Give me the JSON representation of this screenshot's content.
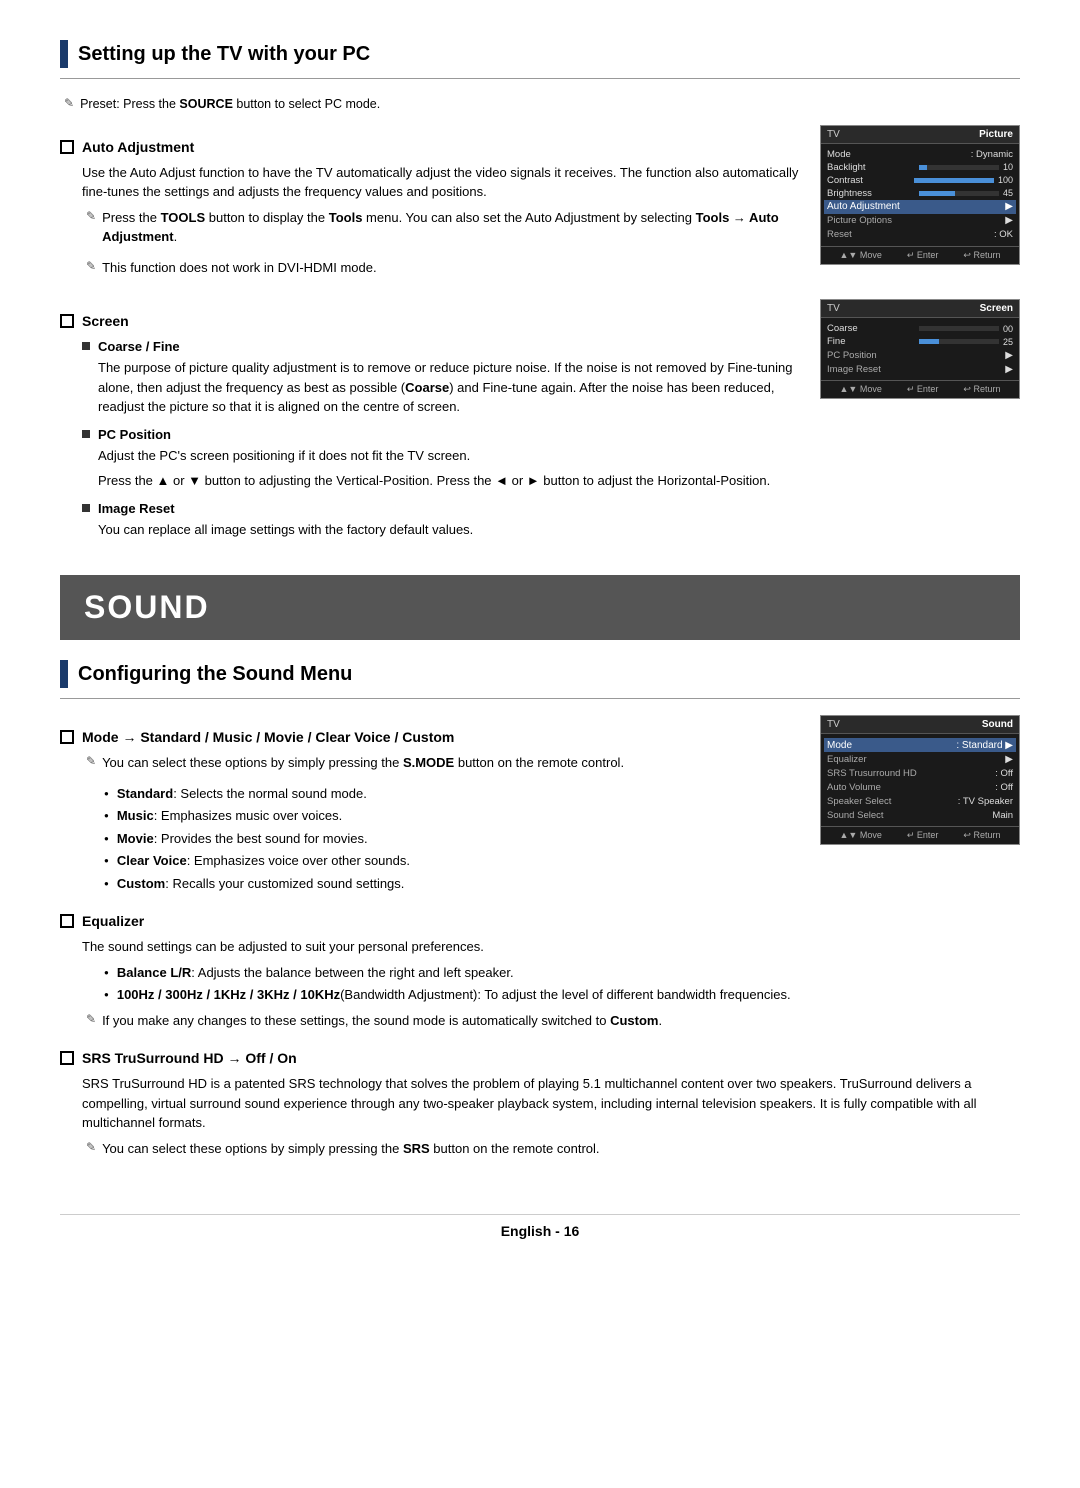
{
  "page": {
    "footer_text": "English - 16"
  },
  "section1": {
    "title": "Setting up the TV with your PC",
    "preset_note": "Preset: Press the SOURCE button to select PC mode.",
    "auto_adjustment": {
      "heading": "Auto Adjustment",
      "para1": "Use the Auto Adjust function to have the TV automatically adjust the video signals it receives. The function also automatically fine-tunes the settings and adjusts the frequency values and positions.",
      "note1": "Press the TOOLS button to display the Tools menu. You can also set the Auto Adjustment by selecting Tools → Auto Adjustment.",
      "note2": "This function does not work in DVI-HDMI mode."
    },
    "screen": {
      "heading": "Screen",
      "coarse_fine": {
        "subheading": "Coarse / Fine",
        "para": "The purpose of picture quality adjustment is to remove or reduce picture noise. If the noise is not removed by Fine-tuning alone, then adjust the frequency as best as possible (Coarse) and Fine-tune again. After the noise has been reduced, readjust the picture so that it is aligned on the centre of screen."
      },
      "pc_position": {
        "subheading": "PC Position",
        "para1": "Adjust the PC's screen positioning if it does not fit the TV screen.",
        "para2": "Press the ▲ or ▼ button to adjusting the Vertical-Position. Press the ◄ or ► button to adjust the Horizontal-Position."
      },
      "image_reset": {
        "subheading": "Image Reset",
        "para": "You can replace all image settings with the factory default values."
      }
    },
    "tv_picture": {
      "header_left": "TV",
      "header_right": "Picture",
      "rows": [
        {
          "label": "Mode",
          "value": ": Dynamic"
        },
        {
          "label": "Backlight",
          "value": "10",
          "is_bar": true,
          "fill_pct": 10
        },
        {
          "label": "Contrast",
          "value": "100",
          "is_bar": true,
          "fill_pct": 100
        },
        {
          "label": "Brightness",
          "value": "45",
          "is_bar": true,
          "fill_pct": 45
        }
      ],
      "selected_row": "Auto Adjustment",
      "extra_rows": [
        {
          "label": "Picture Options",
          "value": ""
        },
        {
          "label": "Reset",
          "value": ": OK"
        }
      ],
      "footer_items": [
        "▲▼ Move",
        "↵ Enter",
        "↩ Return"
      ]
    },
    "tv_screen": {
      "header_left": "TV",
      "header_right": "Screen",
      "rows": [
        {
          "label": "Coarse",
          "value": "00",
          "is_bar": true,
          "fill_pct": 0
        },
        {
          "label": "Fine",
          "value": "25",
          "is_bar": true,
          "fill_pct": 25
        },
        {
          "label": "PC Position",
          "value": ""
        },
        {
          "label": "Image Reset",
          "value": ""
        }
      ],
      "footer_items": [
        "▲▼ Move",
        "↵ Enter",
        "↩ Return"
      ]
    }
  },
  "section2": {
    "banner": "SOUND",
    "title": "Configuring the Sound Menu",
    "mode": {
      "heading": "Mode → Standard / Music / Movie / Clear Voice / Custom",
      "note1": "You can select these options by simply pressing the S.MODE button on the remote control.",
      "bullets": [
        "Standard: Selects the normal sound mode.",
        "Music: Emphasizes music over voices.",
        "Movie: Provides the best sound for movies.",
        "Clear Voice: Emphasizes voice over other sounds.",
        "Custom: Recalls your customized sound settings."
      ]
    },
    "equalizer": {
      "heading": "Equalizer",
      "para": "The sound settings can be adjusted to suit your personal preferences.",
      "bullets": [
        "Balance L/R: Adjusts the balance between the right and left speaker.",
        "100Hz / 300Hz / 1KHz / 3KHz / 10KHz (Bandwidth Adjustment): To adjust the level of different bandwidth frequencies."
      ],
      "note": "If you make any changes to these settings, the sound mode is automatically switched to Custom."
    },
    "srs": {
      "heading": "SRS TruSurround HD → Off / On",
      "para1": "SRS TruSurround HD is a patented SRS technology that solves the problem of playing 5.1 multichannel content over two speakers. TruSurround delivers a compelling, virtual surround sound experience through any two-speaker playback system, including internal television speakers. It is fully compatible with all multichannel formats.",
      "note": "You can select these options by simply pressing the SRS button on the remote control."
    },
    "tv_sound": {
      "header_left": "TV",
      "header_right": "Sound",
      "rows": [
        {
          "label": "Mode",
          "value": ": Standard",
          "selected": true
        },
        {
          "label": "Equalizer",
          "value": ""
        },
        {
          "label": "SRS Trusurround HD",
          "value": ": Off"
        },
        {
          "label": "Auto Volume",
          "value": ": Off"
        },
        {
          "label": "Speaker Select",
          "value": ": TV Speaker"
        },
        {
          "label": "Sound Select",
          "value": "Main"
        }
      ],
      "footer_items": [
        "▲▼ Move",
        "↵ Enter",
        "↩ Return"
      ]
    }
  }
}
